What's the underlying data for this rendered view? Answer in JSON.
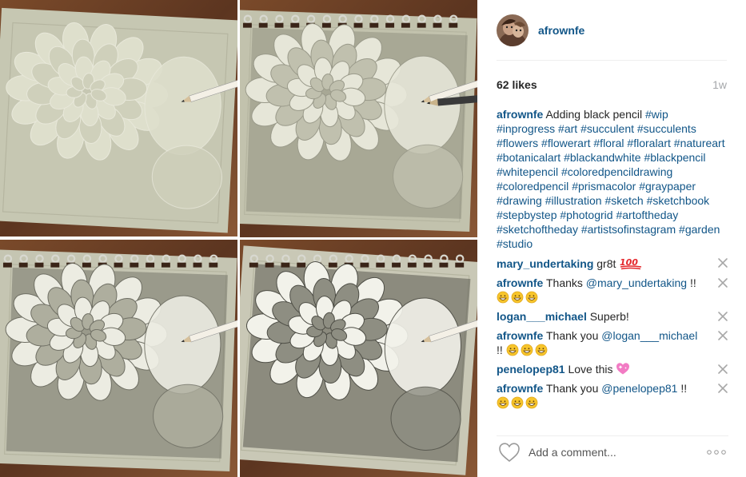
{
  "post": {
    "username": "afrownfe",
    "likes": "62 likes",
    "age": "1w"
  },
  "caption": {
    "user": "afrownfe",
    "text": "Adding black pencil ",
    "hashtags": [
      "#wip",
      "#inprogress",
      "#art",
      "#succulent",
      "#succulents",
      "#flowers",
      "#flowerart",
      "#floral",
      "#floralart",
      "#natureart",
      "#botanicalart",
      "#blackandwhite",
      "#blackpencil",
      "#whitepencil",
      "#coloredpencildrawing",
      "#coloredpencil",
      "#prismacolor",
      "#graypaper",
      "#drawing",
      "#illustration",
      "#sketch",
      "#sketchbook",
      "#stepbystep",
      "#photogrid",
      "#artoftheday",
      "#sketchoftheday",
      "#artistsofinstagram",
      "#garden",
      "#studio"
    ]
  },
  "comments": [
    {
      "user": "mary_undertaking",
      "text": "gr8t",
      "mention": "",
      "after": "",
      "emoji": "hundred-points-icon"
    },
    {
      "user": "afrownfe",
      "text": "Thanks ",
      "mention": "@mary_undertaking",
      "after": " !!",
      "emoji": "grinning-faces-icon"
    },
    {
      "user": "logan___michael",
      "text": "Superb!",
      "mention": "",
      "after": "",
      "emoji": ""
    },
    {
      "user": "afrownfe",
      "text": "Thank you ",
      "mention": "@logan___michael",
      "after": " !!",
      "emoji": "grinning-faces-icon"
    },
    {
      "user": "penelopep81",
      "text": "Love this",
      "mention": "",
      "after": "",
      "emoji": "sparkling-heart-icon"
    },
    {
      "user": "afrownfe",
      "text": "Thank you ",
      "mention": "@penelopep81",
      "after": " !!",
      "emoji": "grinning-faces-icon"
    }
  ],
  "footer": {
    "comment_placeholder": "Add a comment..."
  },
  "colors": {
    "link": "#125688",
    "muted": "#a5a7aa",
    "text": "#262626"
  }
}
